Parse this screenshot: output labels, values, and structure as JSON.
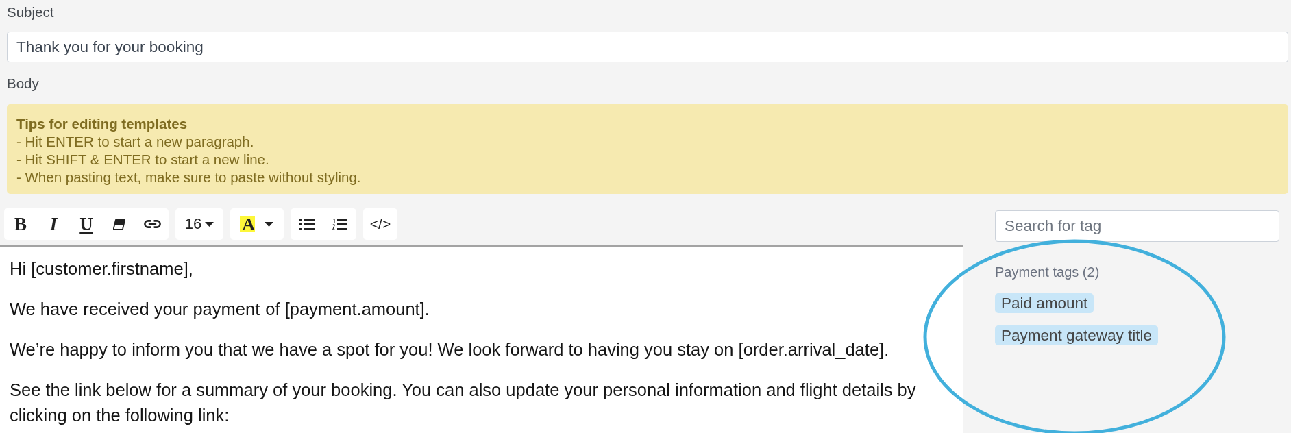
{
  "subject": {
    "label": "Subject",
    "value": "Thank you for your booking"
  },
  "body": {
    "label": "Body"
  },
  "tips": {
    "title": "Tips for editing templates",
    "lines": [
      "- Hit ENTER to start a new paragraph.",
      "- Hit SHIFT & ENTER to start a new line.",
      "- When pasting text, make sure to paste without styling."
    ]
  },
  "toolbar": {
    "groups": [
      {
        "buttons": [
          {
            "kind": "bold",
            "label": "B"
          },
          {
            "kind": "italic",
            "label": "I"
          },
          {
            "kind": "underline",
            "label": "U"
          },
          {
            "kind": "eraser"
          },
          {
            "kind": "link"
          }
        ]
      },
      {
        "buttons": [
          {
            "kind": "font-size",
            "label": "16"
          }
        ]
      },
      {
        "buttons": [
          {
            "kind": "highlight",
            "label": "A"
          },
          {
            "kind": "dropdown"
          }
        ]
      },
      {
        "buttons": [
          {
            "kind": "bullet-list"
          },
          {
            "kind": "numbered-list"
          }
        ]
      },
      {
        "buttons": [
          {
            "kind": "code-view",
            "label": "</>"
          }
        ]
      }
    ]
  },
  "editor": {
    "paragraphs": [
      {
        "text": "Hi [customer.firstname],",
        "caret": false
      },
      {
        "text": "We have received your payment",
        "caret": true,
        "after_caret": "of [payment.amount]."
      },
      {
        "text": "We’re happy to inform you that we have a spot for you! We look forward to having you stay on [order.arrival_date].",
        "caret": false
      },
      {
        "text": "See the link below for a summary of your booking. You can also update your personal information and flight details by clicking on the following link:",
        "caret": false
      }
    ]
  },
  "tag_panel": {
    "search": {
      "placeholder": "Search for tag"
    },
    "groups": [
      {
        "title": "Payment tags (2)",
        "tags": [
          "Paid amount",
          "Payment gateway title"
        ]
      }
    ]
  },
  "annotations": [
    {
      "kind": "ellipse"
    }
  ]
}
